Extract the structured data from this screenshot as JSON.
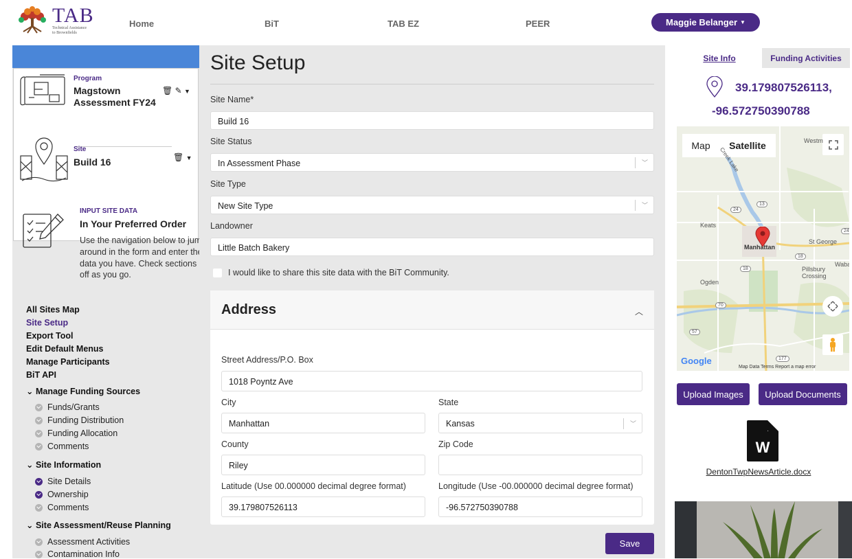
{
  "nav": {
    "logo_text": "TAB",
    "logo_subtitle_1": "Technical Assistance",
    "logo_subtitle_2": "to Brownfields",
    "links": [
      "Home",
      "BiT",
      "TAB EZ",
      "PEER"
    ],
    "user_name": "Maggie Belanger"
  },
  "left": {
    "program_label": "Program",
    "program_name_1": "Magstown",
    "program_name_2": "Assessment FY24",
    "site_label": "Site",
    "site_name": "Build 16",
    "input_title": "INPUT SITE DATA",
    "input_subtitle": "In Your Preferred Order",
    "input_text": "Use the navigation below to jump around in the form and enter the data you have. Check sections off as you go.",
    "main_links": [
      "All Sites Map",
      "Site Setup",
      "Export Tool",
      "Edit Default Menus",
      "Manage Participants",
      "BiT API"
    ],
    "groups": [
      {
        "title": "Manage Funding Sources",
        "items": [
          {
            "label": "Funds/Grants",
            "done": false
          },
          {
            "label": "Funding Distribution",
            "done": false
          },
          {
            "label": "Funding Allocation",
            "done": false
          },
          {
            "label": "Comments",
            "done": false
          }
        ]
      },
      {
        "title": "Site Information",
        "items": [
          {
            "label": "Site Details",
            "done": true
          },
          {
            "label": "Ownership",
            "done": true
          },
          {
            "label": "Comments",
            "done": false
          }
        ]
      },
      {
        "title": "Site Assessment/Reuse Planning",
        "items": [
          {
            "label": "Assessment Activities",
            "done": false
          },
          {
            "label": "Contamination Info",
            "done": false
          }
        ]
      }
    ]
  },
  "form": {
    "title": "Site Setup",
    "site_name_label": "Site Name*",
    "site_name_value": "Build 16",
    "site_status_label": "Site Status",
    "site_status_value": "In Assessment Phase",
    "site_type_label": "Site Type",
    "site_type_value": "New Site Type",
    "landowner_label": "Landowner",
    "landowner_value": "Little Batch Bakery",
    "share_label": "I would like to share this site data with the BiT Community.",
    "share_checked": false,
    "address": {
      "title": "Address",
      "street_label": "Street Address/P.O. Box",
      "street_value": "1018 Poyntz Ave",
      "city_label": "City",
      "city_value": "Manhattan",
      "state_label": "State",
      "state_value": "Kansas",
      "county_label": "County",
      "county_value": "Riley",
      "zip_label": "Zip Code",
      "zip_value": "",
      "lat_label": "Latitude (Use 00.000000 decimal degree format)",
      "lat_value": "39.179807526113",
      "lon_label": "Longitude (Use -00.000000 decimal degree format)",
      "lon_value": "-96.572750390788"
    },
    "save_label": "Save"
  },
  "right": {
    "tabs": [
      "Site Info",
      "Funding Activities"
    ],
    "coord_line_1": "39.179807526113,",
    "coord_line_2": "-96.572750390788",
    "map": {
      "map_btn": "Map",
      "satellite_btn": "Satellite",
      "labels": {
        "westmoreland": "Westm",
        "keats": "Keats",
        "manhattan": "Manhattan",
        "st_george": "St George",
        "pillsbury": "Pillsbury",
        "crossing": "Crossing",
        "ogden": "Ogden",
        "wabaunsee": "Waba",
        "creek_lake": "Creek Lake"
      },
      "routes": [
        "24",
        "13",
        "18",
        "70",
        "24",
        "18",
        "57",
        "177"
      ],
      "google": "Google",
      "footer": "Map Data   Terms   Report a map error"
    },
    "upload_images": "Upload Images",
    "upload_documents": "Upload Documents",
    "doc_letter": "W",
    "doc_name": "DentonTwpNewsArticle.docx"
  },
  "colors": {
    "accent": "#4a2a86",
    "blue_bar": "#4a86d8",
    "panel_bg": "#e8e8e8"
  }
}
